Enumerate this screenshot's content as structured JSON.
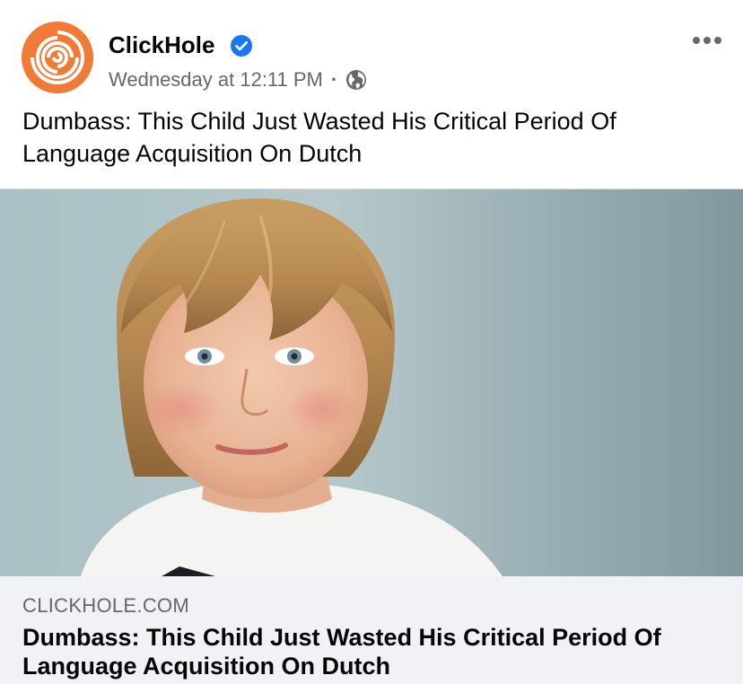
{
  "post": {
    "page_name": "ClickHole",
    "timestamp": "Wednesday at 12:11 PM",
    "separator": "·",
    "text": "Dumbass: This Child Just Wasted His Critical Period Of Language Acquisition On Dutch",
    "verified": true,
    "audience_icon": "globe-icon",
    "options_icon": "more-options-icon"
  },
  "link": {
    "domain": "CLICKHOLE.COM",
    "title": "Dumbass: This Child Just Wasted His Critical Period Of Language Acquisition On Dutch"
  },
  "colors": {
    "brand_orange": "#f17a36",
    "verified_blue": "#1877f2",
    "secondary_text": "#65676b",
    "preview_background": "#f0f2f5"
  }
}
